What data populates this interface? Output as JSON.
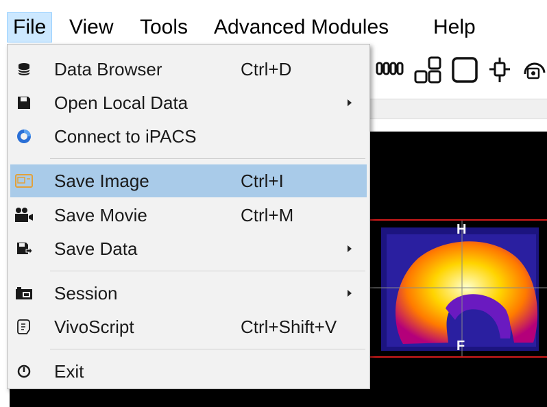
{
  "menubar": {
    "items": [
      {
        "label": "File",
        "active": true
      },
      {
        "label": "View"
      },
      {
        "label": "Tools"
      },
      {
        "label": "Advanced Modules"
      },
      {
        "label": "Help"
      }
    ]
  },
  "file_menu": {
    "items": [
      {
        "label": "Data Browser",
        "shortcut": "Ctrl+D",
        "icon": "database-icon"
      },
      {
        "label": "Open Local Data",
        "shortcut": "",
        "icon": "floppy-disk-icon",
        "submenu": true
      },
      {
        "label": "Connect to iPACS",
        "shortcut": "",
        "icon": "ipacs-ring-icon"
      },
      {
        "label": "Save Image",
        "shortcut": "Ctrl+I",
        "icon": "image-icon",
        "highlighted": true
      },
      {
        "label": "Save Movie",
        "shortcut": "Ctrl+M",
        "icon": "movie-camera-icon"
      },
      {
        "label": "Save Data",
        "shortcut": "",
        "icon": "save-data-icon",
        "submenu": true
      },
      {
        "label": "Session",
        "shortcut": "",
        "icon": "session-icon",
        "submenu": true
      },
      {
        "label": "VivoScript",
        "shortcut": "Ctrl+Shift+V",
        "icon": "script-scroll-icon"
      },
      {
        "label": "Exit",
        "shortcut": "",
        "icon": "power-icon"
      }
    ]
  },
  "viewer": {
    "orientation_top": "H",
    "orientation_bottom": "F"
  },
  "colors": {
    "menu_highlight": "#a9cbe9",
    "menubar_active": "#cce8ff",
    "viewer_bg": "#000000",
    "crosshair": "#d21b1b"
  }
}
